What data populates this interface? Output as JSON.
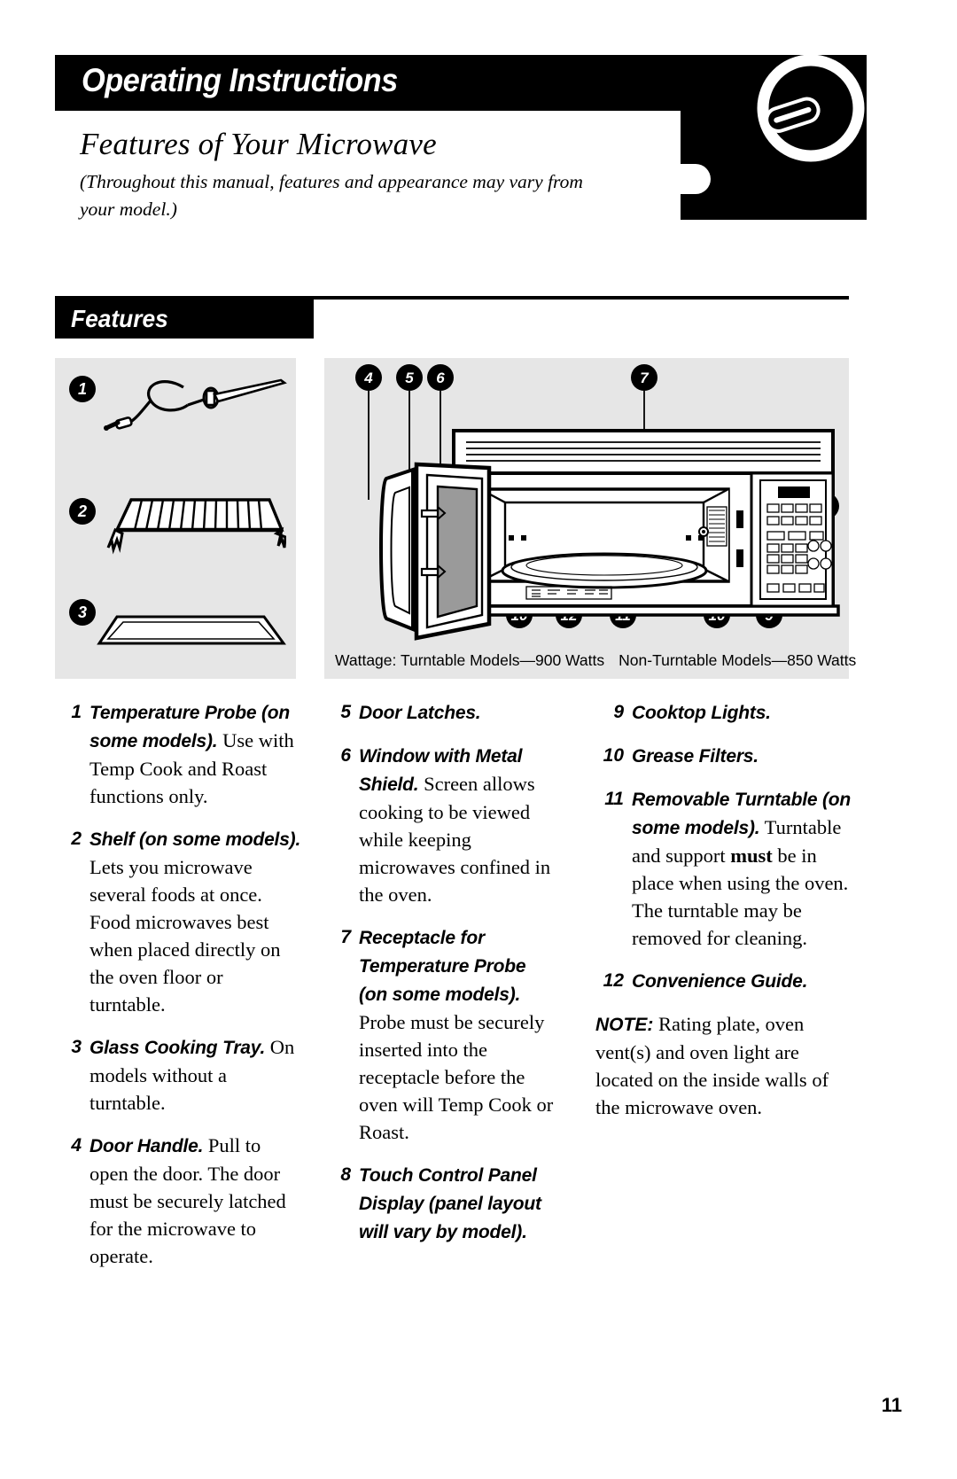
{
  "header": {
    "band_title": "Operating Instructions",
    "section_title": "Features of Your Microwave",
    "section_note": "(Throughout this manual, features and appearance may vary from your model.)",
    "features_band": "Features"
  },
  "diagram": {
    "left_panel_badges": [
      "1",
      "2",
      "3"
    ],
    "left_panel_parts": [
      "temperature-probe",
      "shelf-rack",
      "glass-cooking-tray"
    ],
    "top_badges": [
      "4",
      "5",
      "6",
      "7"
    ],
    "right_badge": "8",
    "bottom_badges": [
      "9",
      "10",
      "12",
      "11",
      "10",
      "9"
    ],
    "wattage_label": "Wattage:",
    "wattage_turntable": "Turntable Models—900 Watts",
    "wattage_non_turntable": "Non-Turntable Models—850 Watts"
  },
  "columns": {
    "col1": [
      {
        "num": "1",
        "title": "Temperature Probe (on some models).",
        "text": " Use with Temp Cook and Roast functions only."
      },
      {
        "num": "2",
        "title": "Shelf (on some models).",
        "text": " Lets you microwave several foods at once. Food microwaves best when placed directly on the oven floor or turntable."
      },
      {
        "num": "3",
        "title": "Glass Cooking Tray.",
        "text": " On models without a turntable."
      },
      {
        "num": "4",
        "title": "Door Handle.",
        "text": " Pull to open the door. The door must be securely latched for the microwave to operate."
      }
    ],
    "col2": [
      {
        "num": "5",
        "title": "Door Latches.",
        "text": ""
      },
      {
        "num": "6",
        "title": "Window with Metal Shield.",
        "text": " Screen allows cooking to be viewed while keeping microwaves confined in the oven."
      },
      {
        "num": "7",
        "title": "Receptacle for Temperature Probe (on some models).",
        "text": " Probe must be securely inserted into the receptacle before the oven will Temp Cook or Roast."
      },
      {
        "num": "8",
        "title": "Touch Control Panel Display (panel layout will vary by model).",
        "text": ""
      }
    ],
    "col3": [
      {
        "num": "9",
        "title": "Cooktop Lights.",
        "text": ""
      },
      {
        "num": "10",
        "title": "Grease Filters.",
        "text": ""
      },
      {
        "num": "11",
        "title": "Removable Turntable (on some models).",
        "text_before": " Turntable and support ",
        "emphasis": "must",
        "text_after": " be in place when using the oven. The turntable may be removed for cleaning."
      },
      {
        "num": "12",
        "title": "Convenience Guide.",
        "text": ""
      }
    ],
    "note_label": "NOTE:",
    "note_text": " Rating plate, oven vent(s) and oven light are located on the inside walls of the microwave oven."
  },
  "footer": {
    "page_number": "11"
  },
  "colors": {
    "ink": "#000000",
    "panel": "#e6e6e6",
    "paper": "#ffffff"
  }
}
